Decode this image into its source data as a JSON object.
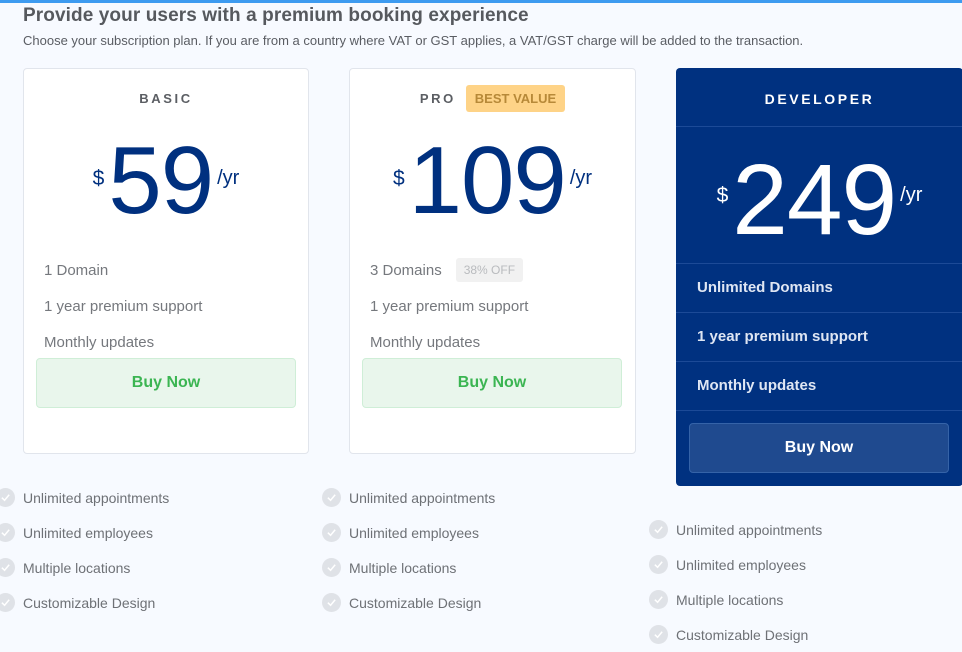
{
  "header": {
    "title": "Provide your users with a premium booking experience",
    "subtitle": "Choose your subscription plan. If you are from a country where VAT or GST applies, a VAT/GST charge will be added to the transaction."
  },
  "colors": {
    "accent_bar": "#3d9bf0",
    "price_blue": "#00307f",
    "developer_bg": "#003180",
    "buy_green": "#3bb552",
    "best_value_bg": "#fed387"
  },
  "plans": [
    {
      "name": "BASIC",
      "currency": "$",
      "amount": "59",
      "period": "/yr",
      "features": [
        "1 Domain",
        "1 year premium support",
        "Monthly updates"
      ],
      "button": "Buy Now",
      "perks": [
        "Unlimited appointments",
        "Unlimited employees",
        "Multiple locations",
        "Customizable Design"
      ]
    },
    {
      "name": "PRO",
      "badge": "BEST VALUE",
      "currency": "$",
      "amount": "109",
      "period": "/yr",
      "features": [
        "3 Domains",
        "1 year premium support",
        "Monthly updates"
      ],
      "discount_badge": "38% OFF",
      "button": "Buy Now",
      "perks": [
        "Unlimited appointments",
        "Unlimited employees",
        "Multiple locations",
        "Customizable Design"
      ]
    },
    {
      "name": "DEVELOPER",
      "currency": "$",
      "amount": "249",
      "period": "/yr",
      "features": [
        "Unlimited Domains",
        "1 year premium support",
        "Monthly updates"
      ],
      "button": "Buy Now",
      "perks": [
        "Unlimited appointments",
        "Unlimited employees",
        "Multiple locations",
        "Customizable Design"
      ]
    }
  ]
}
